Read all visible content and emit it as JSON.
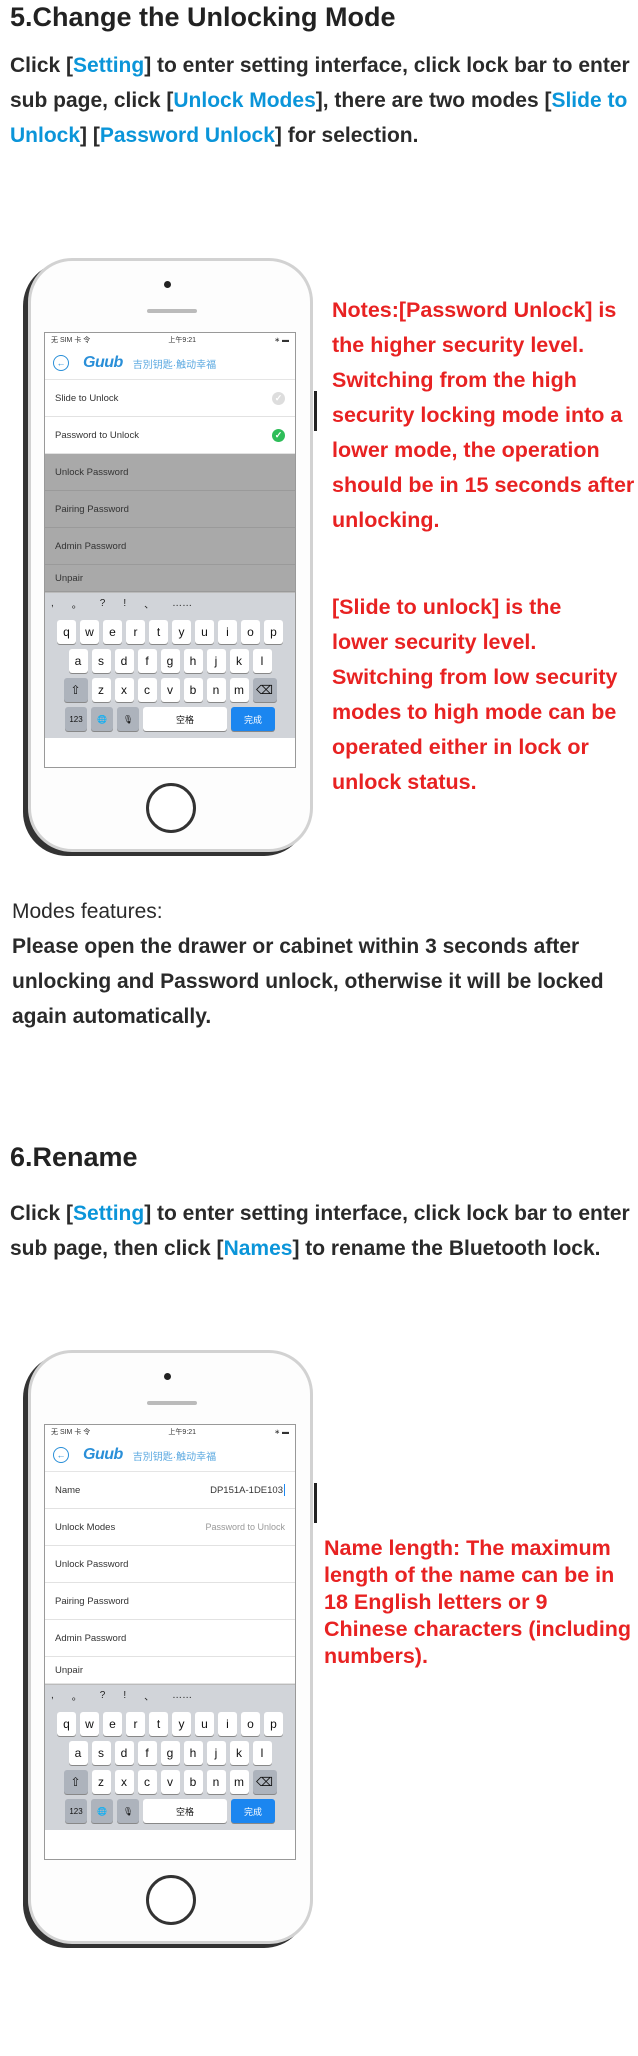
{
  "section5": {
    "title": "5.Change the Unlocking Mode",
    "intro": {
      "t1": "Click [",
      "setting": "Setting",
      "t2": "] to enter setting interface, click lock bar to enter sub page, click [",
      "unlock_modes": "Unlock Modes",
      "t3": "], there are two modes [",
      "slide": "Slide to Unlock",
      "t4": "] [",
      "password": "Password Unlock",
      "t5": "] for selection."
    },
    "note1": "Notes:[Password Unlock] is the higher security level. Switching from the high security locking mode into a lower mode, the operation should be in 15 seconds after unlocking.",
    "note2": "[Slide to unlock] is the lower security level. Switching from low security modes to high mode can be operated either in lock or unlock status.",
    "features_title": "Modes features:",
    "features_text": "Please open the drawer or cabinet within 3 seconds after unlocking and Password unlock, otherwise it will be locked again automatically."
  },
  "section6": {
    "title": "6.Rename",
    "intro": {
      "t1": "Click [",
      "setting": "Setting",
      "t2": "] to enter setting interface, click lock bar to enter sub page, then click [",
      "names": "Names",
      "t3": "] to rename the Bluetooth lock."
    },
    "note": "Name length: The maximum length of the name can be in 18 English letters or 9 Chinese characters (including numbers)."
  },
  "phone1": {
    "status_left": "无 SIM 卡 令",
    "status_time": "上午9:21",
    "status_right": "∗ ▬",
    "logo": "Guub",
    "logo_sub": "吉別钥匙·触动幸福",
    "rows": [
      {
        "label": "Slide to Unlock",
        "checked": false
      },
      {
        "label": "Password to Unlock",
        "checked": true
      }
    ],
    "gray_rows": [
      "Unlock Password",
      "Pairing Password",
      "Admin Password",
      "Unpair"
    ]
  },
  "phone2": {
    "status_left": "无 SIM 卡 令",
    "status_time": "上午9:21",
    "status_right": "∗ ▬",
    "logo": "Guub",
    "logo_sub": "吉別钥匙·触动幸福",
    "name_label": "Name",
    "name_value": "DP151A-1DE103",
    "mode_label": "Unlock Modes",
    "mode_value": "Password to Unlock",
    "rows": [
      "Unlock Password",
      "Pairing Password",
      "Admin Password",
      "Unpair"
    ]
  },
  "keyboard": {
    "suggestions": [
      ",",
      "。",
      "?",
      "!",
      "、",
      "……"
    ],
    "row1": [
      "q",
      "w",
      "e",
      "r",
      "t",
      "y",
      "u",
      "i",
      "o",
      "p"
    ],
    "row2": [
      "a",
      "s",
      "d",
      "f",
      "g",
      "h",
      "j",
      "k",
      "l"
    ],
    "row3": [
      "z",
      "x",
      "c",
      "v",
      "b",
      "n",
      "m"
    ],
    "shift": "⇧",
    "delete": "⌫",
    "num": "123",
    "globe": "🌐",
    "mic": "🎙",
    "space": "空格",
    "done": "完成"
  }
}
